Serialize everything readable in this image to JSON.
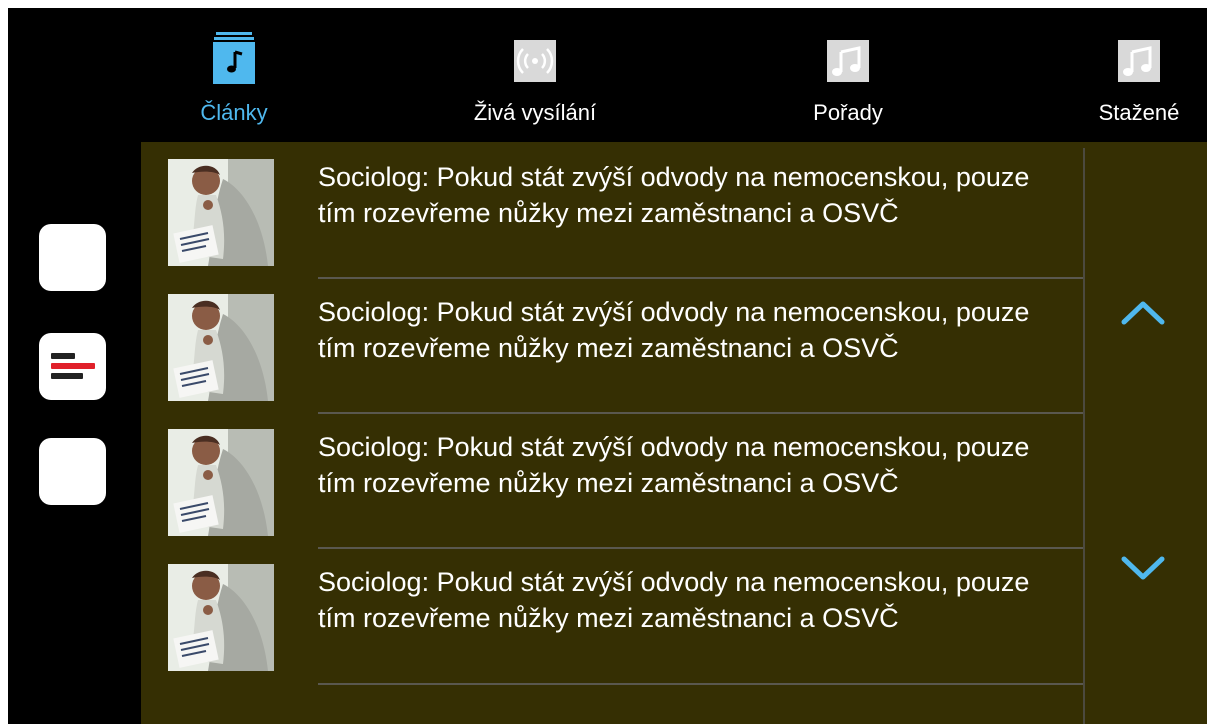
{
  "tabs": [
    {
      "label": "Články",
      "icon": "music-note-stack-icon",
      "active": true
    },
    {
      "label": "Živá vysílání",
      "icon": "broadcast-icon",
      "active": false
    },
    {
      "label": "Pořady",
      "icon": "music-note-icon",
      "active": false
    },
    {
      "label": "Stažené",
      "icon": "music-note-icon",
      "active": false
    }
  ],
  "side_buttons": [
    {
      "name": "side-button-blank-top",
      "icon": ""
    },
    {
      "name": "side-button-list",
      "icon": "list-lines-icon"
    },
    {
      "name": "side-button-blank-bottom",
      "icon": ""
    }
  ],
  "articles": [
    {
      "title": "Sociolog: Pokud stát zvýší odvody na nemocenskou, pouze tím rozevřeme nůžky mezi zaměstnanci a OSVČ"
    },
    {
      "title": "Sociolog: Pokud stát zvýší odvody na nemocenskou, pouze tím rozevřeme nůžky mezi zaměstnanci a OSVČ"
    },
    {
      "title": "Sociolog: Pokud stát zvýší odvody na nemocenskou, pouze tím rozevřeme nůžky mezi zaměstnanci a OSVČ"
    },
    {
      "title": "Sociolog: Pokud stát zvýší odvody na nemocenskou, pouze tím rozevřeme nůžky mezi zaměstnanci a OSVČ"
    }
  ],
  "colors": {
    "accent": "#4fb8ee",
    "panel": "#352f03",
    "background": "#000000",
    "list_bar_red": "#e0202a",
    "list_bar_dark": "#222222"
  }
}
